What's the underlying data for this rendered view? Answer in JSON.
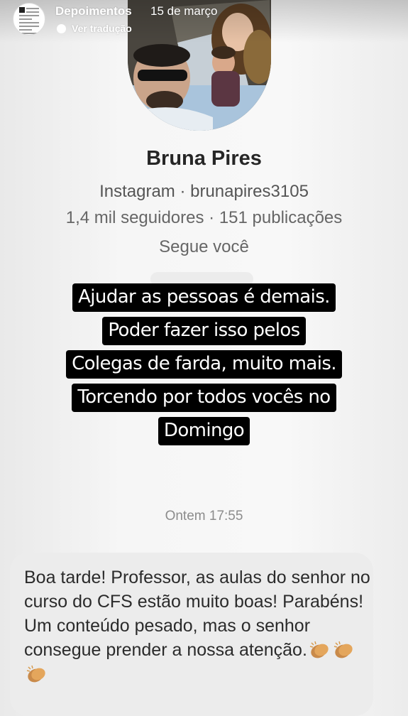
{
  "story": {
    "account_name": "Depoimentos",
    "date": "15 de março",
    "translate_label": "Ver tradução"
  },
  "profile": {
    "name": "Bruna Pires",
    "platform_line": "Instagram · brunapires3105",
    "stats_line": "1,4 mil seguidores · 151 publicações",
    "follows_line": "Segue você"
  },
  "caption": {
    "lines": [
      "Ajudar as pessoas é demais.",
      "Poder fazer isso pelos",
      "Colegas de farda, muito mais.",
      "Torcendo por todos vocês no",
      "Domingo"
    ]
  },
  "message": {
    "timestamp": "Ontem 17:55",
    "text": "Boa tarde! Professor, as aulas do senhor no curso do CFS estão muito boas! Parabéns! Um conteúdo pesado, mas o senhor consegue prender a nossa atenção.",
    "emoji_icons": [
      "clapping-hands-icon",
      "clapping-hands-icon",
      "clapping-hands-icon"
    ]
  }
}
